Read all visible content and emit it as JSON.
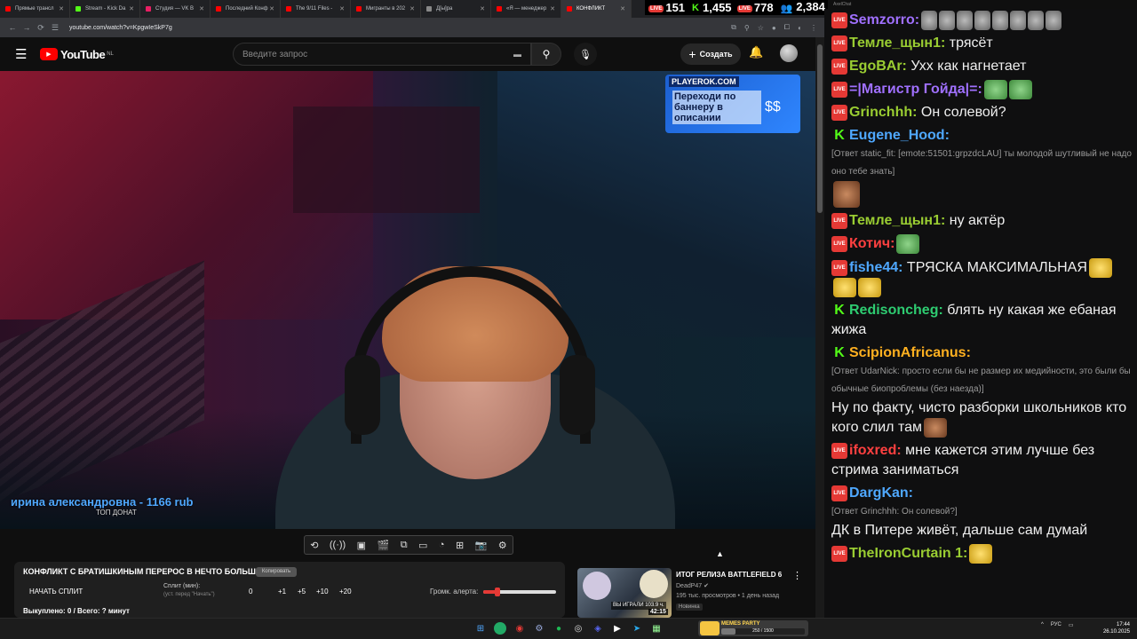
{
  "tabs": [
    {
      "label": "Прямые трансл",
      "color": "#ff0000"
    },
    {
      "label": "Stream - Kick Da",
      "color": "#53fc18"
    },
    {
      "label": "Студия — VK В",
      "color": "#e91e63"
    },
    {
      "label": "Последний Конф",
      "color": "#ff0000"
    },
    {
      "label": "The 9/11 Files -",
      "color": "#ff0000"
    },
    {
      "label": "Мигранты в 202",
      "color": "#ff0000"
    },
    {
      "label": "Д[ы]ра",
      "color": "#888888"
    },
    {
      "label": "«Я — менеджер",
      "color": "#ff0000"
    },
    {
      "label": "КОНФЛИКТ",
      "color": "#ff0000"
    }
  ],
  "browser": {
    "url": "youtube.com/watch?v=KpgwIeSkP7g"
  },
  "youtube": {
    "logo": "YouTube",
    "region": "NL",
    "search_placeholder": "Введите запрос",
    "create_label": "Создать"
  },
  "ad_banner": {
    "brand": "PLAYEROK.COM",
    "text": "Переходи по баннеру в описании"
  },
  "overlay": {
    "top_donate": "ирина александровна - 1166 rub",
    "top_donate_caption": "ТОП ДОНАТ"
  },
  "panel": {
    "title": "КОНФЛИКТ С БРАТИШКИНЫМ ПЕРЕРОС В НЕЧТО БОЛЬШЕЕ...",
    "copy_label": "Копировать",
    "start_split": "НАЧАТЬ СПЛИТ",
    "split_label": "Сплит (мин):",
    "split_hint": "(уст. перед \"Начать\")",
    "split_value": "0",
    "btn1": "+1",
    "btn5": "+5",
    "btn10": "+10",
    "btn20": "+20",
    "volume_label": "Громк. алерта:",
    "volume_level": 0.2,
    "bought": "Выкуплено: 0 / Всего: ? минут"
  },
  "recommendation": {
    "title": "ИТОГ РЕЛИЗА BATTLEFIELD 6",
    "channel": "DeadP47 ✔",
    "stats": "195 тыс. просмотров • 1 день назад",
    "badge": "Новинка",
    "duration": "42:15",
    "played": "ВЫ ИГРАЛИ 103.9 ч."
  },
  "stats_bar": {
    "yt_viewers": "151",
    "kick_viewers": "1,455",
    "vk_viewers": "778",
    "total": "2,384",
    "live_badge": "LIVE"
  },
  "chat_title": "AxelChat",
  "chat": [
    {
      "platform": "live",
      "user": "Semzorro:",
      "color": "#a070ff",
      "text": "",
      "reply": "",
      "emote": "gray"
    },
    {
      "platform": "live",
      "user": "Темле_щын1:",
      "color": "#9acd32",
      "text": "трясёт",
      "reply": "",
      "emote": ""
    },
    {
      "platform": "live",
      "user": "EgoBAr:",
      "color": "#9acd32",
      "text": "Ухх как нагнетает",
      "reply": "",
      "emote": ""
    },
    {
      "platform": "live",
      "user": "=|Магистр Гойда|=:",
      "color": "#a070ff",
      "text": "",
      "reply": "",
      "emote": "green"
    },
    {
      "platform": "live",
      "user": "Grinchhh:",
      "color": "#9acd32",
      "text": "Он солевой?",
      "reply": "",
      "emote": ""
    },
    {
      "platform": "kick",
      "user": "Eugene_Hood:",
      "color": "#4fa8ff",
      "text": "",
      "reply": "[Ответ static_fit: [emote:51501:grpzdcLAU] ты молодой шутливый не надо оно тебе знать]",
      "emote": "face"
    },
    {
      "platform": "live",
      "user": "Темле_щын1:",
      "color": "#9acd32",
      "text": "ну актёр",
      "reply": "",
      "emote": ""
    },
    {
      "platform": "live",
      "user": "Котич:",
      "color": "#ff4040",
      "text": "",
      "reply": "",
      "emote": "green"
    },
    {
      "platform": "live",
      "user": "fishe44:",
      "color": "#4fa8ff",
      "text": "ТРЯСКА МАКСИМАЛЬНАЯ",
      "reply": "",
      "emote": "yellow"
    },
    {
      "platform": "kick",
      "user": "Redisoncheg:",
      "color": "#2ecc71",
      "text": "блять ну какая же ебаная жижа",
      "reply": "",
      "emote": ""
    },
    {
      "platform": "kick",
      "user": "ScipionAfricanus:",
      "color": "#ffb020",
      "text": "Ну по факту, чисто разборки школьников кто кого слил там",
      "reply": "[Ответ UdarNick: просто если бы не размер их медийности, это были бы обычные биопроблемы (без наезда)]",
      "emote": "face"
    },
    {
      "platform": "live",
      "user": "ifoxred:",
      "color": "#ff4040",
      "text": "мне кажется этим лучше без стрима заниматься",
      "reply": "",
      "emote": ""
    },
    {
      "platform": "live",
      "user": "DargKan:",
      "color": "#4fa8ff",
      "text": "ДК в Питере живёт, дальше сам думай",
      "reply": "[Ответ Grinchhh: Он солевой?]",
      "emote": ""
    },
    {
      "platform": "live",
      "user": "TheIronCurtain 1:",
      "color": "#9acd32",
      "text": "",
      "reply": "",
      "emote": "yellow"
    }
  ],
  "taskbar": {
    "memes_title": "MEMES PARTY",
    "memes_count": "250 / 1500",
    "memes_progress": 0.1667,
    "lang": "РУС",
    "time": "17:44",
    "date": "26.10.2025"
  }
}
